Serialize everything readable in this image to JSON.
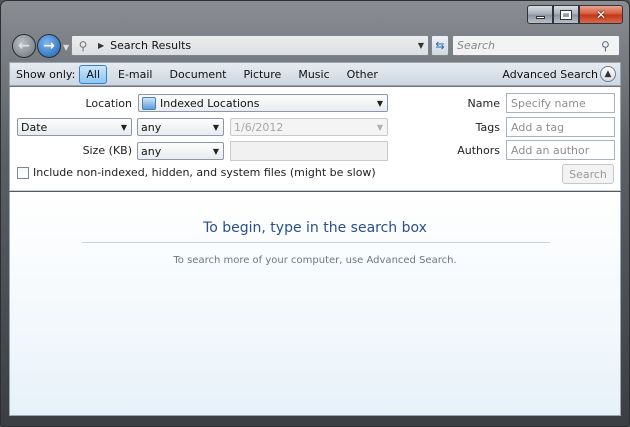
{
  "window": {
    "caption_buttons": {
      "minimize": "minimize-icon",
      "maximize": "maximize-icon",
      "close_glyph": "✕"
    }
  },
  "address_bar": {
    "path_label": "Search Results",
    "search_placeholder": "Search"
  },
  "filter_bar": {
    "show_only_label": "Show only:",
    "filters": [
      "All",
      "E-mail",
      "Document",
      "Picture",
      "Music",
      "Other"
    ],
    "active_filter": "All",
    "advanced_search_label": "Advanced Search"
  },
  "advanced": {
    "location_label": "Location",
    "location_value": "Indexed Locations",
    "date_type": "Date",
    "date_comparator": "any",
    "date_value": "1/6/2012",
    "size_label": "Size (KB)",
    "size_comparator": "any",
    "size_value": "",
    "name_label": "Name",
    "name_placeholder": "Specify name",
    "tags_label": "Tags",
    "tags_placeholder": "Add a tag",
    "authors_label": "Authors",
    "authors_placeholder": "Add an author",
    "include_label": "Include non-indexed, hidden, and system files (might be slow)",
    "include_checked": false,
    "search_button": "Search"
  },
  "results": {
    "headline": "To begin, type in the search box",
    "hint": "To search more of your computer, use Advanced Search."
  },
  "colors": {
    "accent": "#2a4f8a",
    "active_filter_bg": "#8cc7f3",
    "close_button": "#c2361a"
  }
}
